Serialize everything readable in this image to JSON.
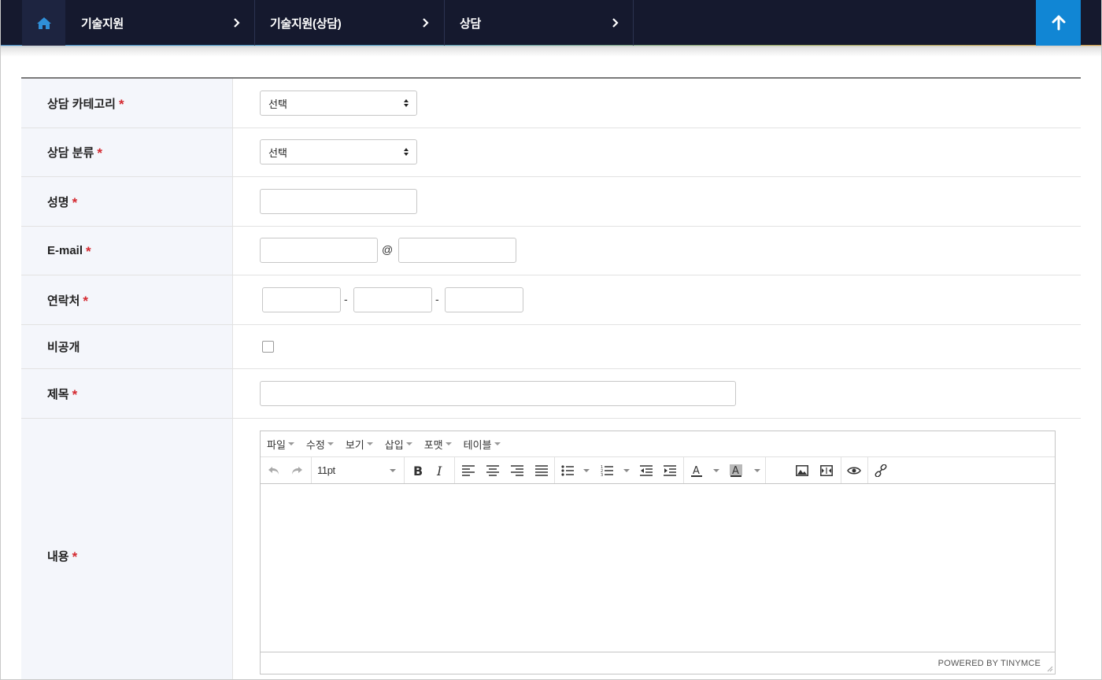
{
  "breadcrumb": {
    "home_icon": "home-icon",
    "items": [
      {
        "label": "기술지원"
      },
      {
        "label": "기술지원(상담)"
      },
      {
        "label": "상담"
      }
    ],
    "chevron_icon": "chevron-right-icon",
    "scroll_top_icon": "arrow-up-icon"
  },
  "colors": {
    "nav_bg": "#15192e",
    "accent_blue": "#1186d4",
    "required": "#d4282f",
    "label_bg": "#f4f6fb"
  },
  "form": {
    "required_mark": "*",
    "category": {
      "label": "상담 카테고리",
      "value": "선택"
    },
    "classification": {
      "label": "상담 분류",
      "value": "선택"
    },
    "name": {
      "label": "성명",
      "value": ""
    },
    "email": {
      "label": "E-mail",
      "at": "@",
      "local": "",
      "domain": ""
    },
    "phone": {
      "label": "연락처",
      "dash": "-",
      "part1": "",
      "part2": "",
      "part3": ""
    },
    "private": {
      "label": "비공개",
      "checked": false
    },
    "subject": {
      "label": "제목",
      "value": ""
    },
    "content": {
      "label": "내용"
    }
  },
  "editor": {
    "menus": [
      "파일",
      "수정",
      "보기",
      "삽입",
      "포맷",
      "테이블"
    ],
    "font_size": "11pt",
    "toolbar_icons": [
      "undo-icon",
      "redo-icon",
      "bold-icon",
      "italic-icon",
      "align-left-icon",
      "align-center-icon",
      "align-right-icon",
      "align-justify-icon",
      "bullet-list-icon",
      "numbered-list-icon",
      "outdent-icon",
      "indent-icon",
      "text-color-icon",
      "background-color-icon",
      "image-icon",
      "media-icon",
      "preview-icon",
      "link-icon"
    ],
    "powered_by": "POWERED BY TINYMCE"
  }
}
